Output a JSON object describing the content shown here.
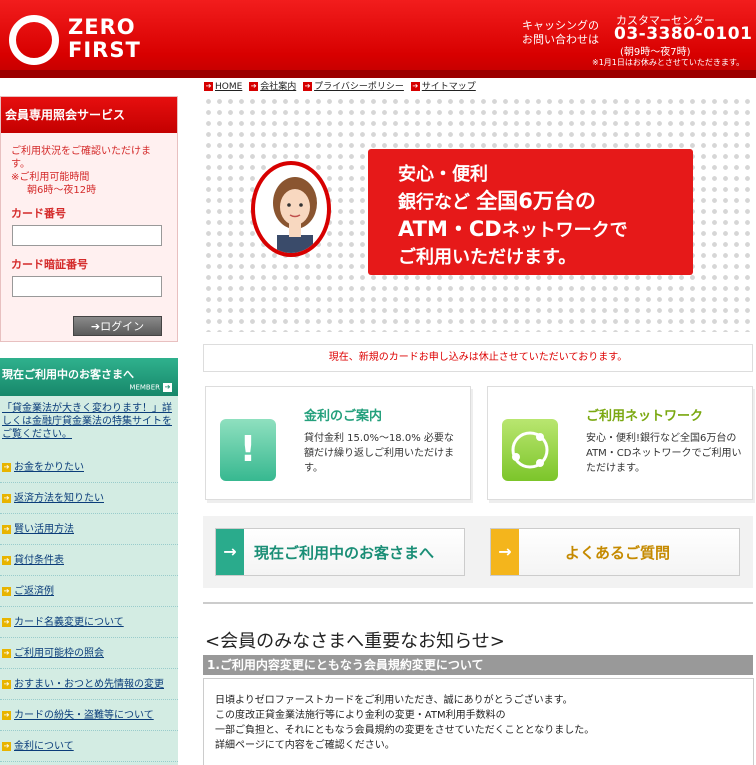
{
  "header": {
    "logo_line1": "ZERO",
    "logo_line2": "FIRST",
    "cashing_line1": "キャッシングの",
    "cashing_line2": "お問い合わせは",
    "center_label": "カスタマーセンター",
    "phone": "03-3380-0101",
    "hours": "(朝9時〜夜7時)",
    "holiday_note": "※1月1日はお休みとさせていただきます。"
  },
  "breadcrumb": [
    {
      "label": "HOME"
    },
    {
      "label": "会社案内"
    },
    {
      "label": "プライバシーポリシー"
    },
    {
      "label": "サイトマップ"
    }
  ],
  "login": {
    "title": "会員専用照会サービス",
    "desc1": "ご利用状況をご確認いただけます。",
    "desc2": "※ご利用可能時間",
    "desc3": "朝6時〜夜12時",
    "card_label": "カード番号",
    "pin_label": "カード暗証番号",
    "button": "ログイン"
  },
  "member": {
    "title": "現在ご利用中のお客さまへ",
    "sub": "MEMBER",
    "notice": "「貸金業法が大きく変わります！」詳しくは金融庁貸金業法の特集サイトをご覧ください。",
    "items": [
      "お金をかりたい",
      "返済方法を知りたい",
      "賢い活用方法",
      "貸付条件表",
      "ご返済例",
      "カード名義変更について",
      "ご利用可能枠の照会",
      "おすまい・おつとめ先情報の変更",
      "カードの紛失・盗難等について",
      "金利について"
    ]
  },
  "hero": {
    "line1": "安心・便利",
    "line2a": "銀行など ",
    "line2b": "全国6万台の",
    "line3a": "ATM・CD",
    "line3b": "ネットワークで",
    "line4": "ご利用いただけます。"
  },
  "suspend_notice": "現在、新規のカードお申し込みは休止させていただいております。",
  "card_rate": {
    "title": "金利のご案内",
    "body": "貸付金利 15.0%〜18.0% 必要な額だけ繰り返しご利用いただけます。"
  },
  "card_network": {
    "title": "ご利用ネットワーク",
    "body": "安心・便利!銀行など全国6万台のATM・CDネットワークでご利用いただけます。"
  },
  "buttons": {
    "current": "現在ご利用中のお客さまへ",
    "faq": "よくあるご質問"
  },
  "important": {
    "title": "<会員のみなさまへ重要なお知らせ>",
    "item1_title": "1.ご利用内容変更にともなう会員規約変更について",
    "line1": "日頃よりゼロファーストカードをご利用いただき、誠にありがとうございます。",
    "line2": "この度改正貸金業法施行等により金利の変更・ATM利用手数料の",
    "line3": "一部ご負担と、それにともなう会員規約の変更をさせていただくこととなりました。",
    "line4": "詳細ページにて内容をご確認ください。"
  },
  "colors": {
    "brand_red": "#e61919",
    "member_green": "#2aab8c",
    "faq_yellow": "#f4b51c"
  }
}
